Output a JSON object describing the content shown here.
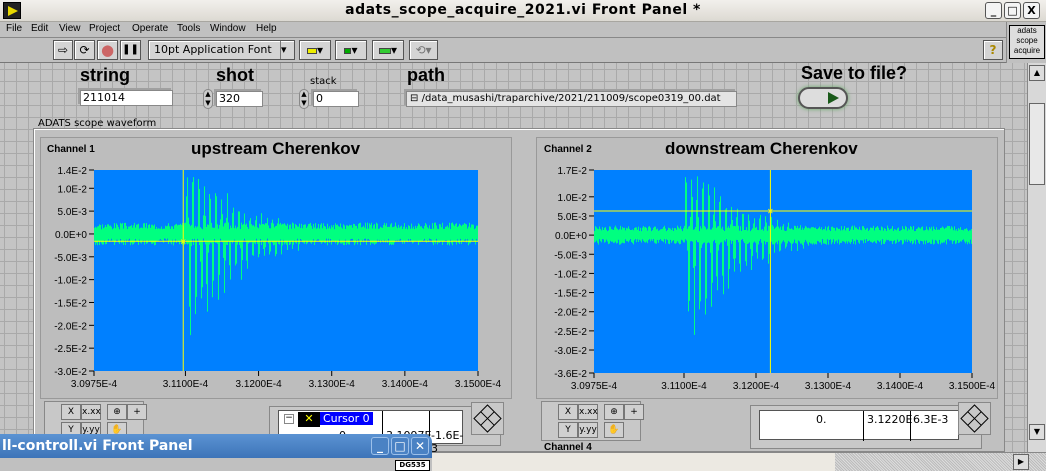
{
  "window": {
    "title": "adats_scope_acquire_2021.vi Front Panel *",
    "minimize": "_",
    "maximize": "□",
    "close": "X"
  },
  "menu": [
    "File",
    "Edit",
    "View",
    "Project",
    "Operate",
    "Tools",
    "Window",
    "Help"
  ],
  "toolbar": {
    "run": "⇨",
    "run_continuous": "⟳",
    "abort": "●",
    "pause": "❚❚",
    "font": "10pt Application Font",
    "dropdown": "▾",
    "help": "?",
    "vi_icon": [
      "adats",
      "scope",
      "acquire"
    ]
  },
  "controls": {
    "string": {
      "label": "string",
      "value": "211014"
    },
    "shot": {
      "label": "shot",
      "value": "320"
    },
    "stack": {
      "label": "stack",
      "value": "0"
    },
    "path": {
      "label": "path",
      "value": "/data_musashi/traparchive/2021/211009/scope0319_00.dat"
    },
    "save": {
      "label": "Save to file?",
      "state": "off"
    }
  },
  "waveform_group_label": "ADATS scope waveform",
  "chart_data": [
    {
      "type": "line",
      "channel": "Channel 1",
      "title": "upstream Cherenkov",
      "xlim": [
        0.00030975,
        0.000315
      ],
      "ylim": [
        -0.03,
        0.014
      ],
      "x_ticks": [
        "3.0975E-4",
        "3.1100E-4",
        "3.1200E-4",
        "3.1300E-4",
        "3.1400E-4",
        "3.1500E-4"
      ],
      "y_ticks": [
        "1.4E-2",
        "1.0E-2",
        "5.0E-3",
        "0.0E+0",
        "-5.0E-3",
        "-1.0E-2",
        "-1.5E-2",
        "-2.0E-2",
        "-2.5E-2",
        "-3.0E-2"
      ],
      "series": [
        {
          "name": "Channel 1",
          "color": "#00ff80",
          "baseline_noise": 0.0025,
          "pulse_start": 0.000311,
          "min": -0.03,
          "max": 0.014
        }
      ],
      "cursor": {
        "name": "Cursor 0",
        "x": 0.00031097,
        "y": -0.0016,
        "x_text": "3.1097E",
        "y_text": "-1.6E-3",
        "row": "0",
        "color": "#ffff00"
      },
      "plot_bg": "#0080ff"
    },
    {
      "type": "line",
      "channel": "Channel 2",
      "title": "downstream Cherenkov",
      "xlim": [
        0.00030975,
        0.000315
      ],
      "ylim": [
        -0.036,
        0.017
      ],
      "x_ticks": [
        "3.0975E-4",
        "3.1100E-4",
        "3.1200E-4",
        "3.1300E-4",
        "3.1400E-4",
        "3.1500E-4"
      ],
      "y_ticks": [
        "1.7E-2",
        "1.0E-2",
        "5.0E-3",
        "0.0E+0",
        "-5.0E-3",
        "-1.0E-2",
        "-1.5E-2",
        "-2.0E-2",
        "-2.5E-2",
        "-3.0E-2",
        "-3.6E-2"
      ],
      "series": [
        {
          "name": "Channel 2",
          "color": "#00ff80",
          "baseline_noise": 0.0025,
          "pulse_start": 0.000311,
          "min": -0.036,
          "max": 0.017
        }
      ],
      "cursor": {
        "x": 0.0003122,
        "y": 0.0063,
        "x_text": "3.1220E",
        "y_text": "6.3E-3",
        "row": "0.",
        "color": "#ffff00"
      },
      "plot_bg": "#0080ff"
    }
  ],
  "palette": {
    "x_label": "X",
    "y_label": "Y",
    "x_fmt": "x.xx",
    "y_fmt": "y.yy",
    "zoom": "⊕",
    "cursor": "+",
    "pan": "✋"
  },
  "channel4_label": "Channel 4",
  "subwindow": {
    "title": "ll-controll.vi Front Panel",
    "minimize": "_",
    "maximize": "□",
    "close": "✕",
    "badge": "DG535"
  }
}
